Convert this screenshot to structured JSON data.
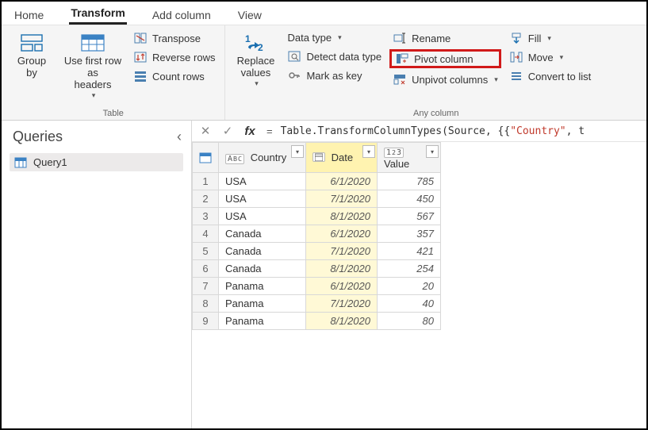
{
  "tabs": {
    "home": "Home",
    "transform": "Transform",
    "addcolumn": "Add column",
    "view": "View"
  },
  "ribbon": {
    "table": {
      "groupby": "Group\nby",
      "firstrow": "Use first row as\nheaders",
      "transpose": "Transpose",
      "reverse": "Reverse rows",
      "count": "Count rows",
      "label": "Table"
    },
    "anycol": {
      "replace": "Replace\nvalues",
      "datatype": "Data type",
      "detect": "Detect data type",
      "markkey": "Mark as key",
      "rename": "Rename",
      "pivot": "Pivot column",
      "unpivot": "Unpivot columns",
      "fill": "Fill",
      "move": "Move",
      "convert": "Convert to list",
      "label": "Any column"
    }
  },
  "sidebar": {
    "title": "Queries",
    "item1": "Query1"
  },
  "formula": {
    "prefix": "Table.TransformColumnTypes(Source, {{",
    "str": "\"Country\"",
    "suffix": ", t"
  },
  "columns": {
    "country": "Country",
    "date": "Date",
    "value": "Value"
  },
  "rows": [
    {
      "n": "1",
      "country": "USA",
      "date": "6/1/2020",
      "value": "785"
    },
    {
      "n": "2",
      "country": "USA",
      "date": "7/1/2020",
      "value": "450"
    },
    {
      "n": "3",
      "country": "USA",
      "date": "8/1/2020",
      "value": "567"
    },
    {
      "n": "4",
      "country": "Canada",
      "date": "6/1/2020",
      "value": "357"
    },
    {
      "n": "5",
      "country": "Canada",
      "date": "7/1/2020",
      "value": "421"
    },
    {
      "n": "6",
      "country": "Canada",
      "date": "8/1/2020",
      "value": "254"
    },
    {
      "n": "7",
      "country": "Panama",
      "date": "6/1/2020",
      "value": "20"
    },
    {
      "n": "8",
      "country": "Panama",
      "date": "7/1/2020",
      "value": "40"
    },
    {
      "n": "9",
      "country": "Panama",
      "date": "8/1/2020",
      "value": "80"
    }
  ]
}
